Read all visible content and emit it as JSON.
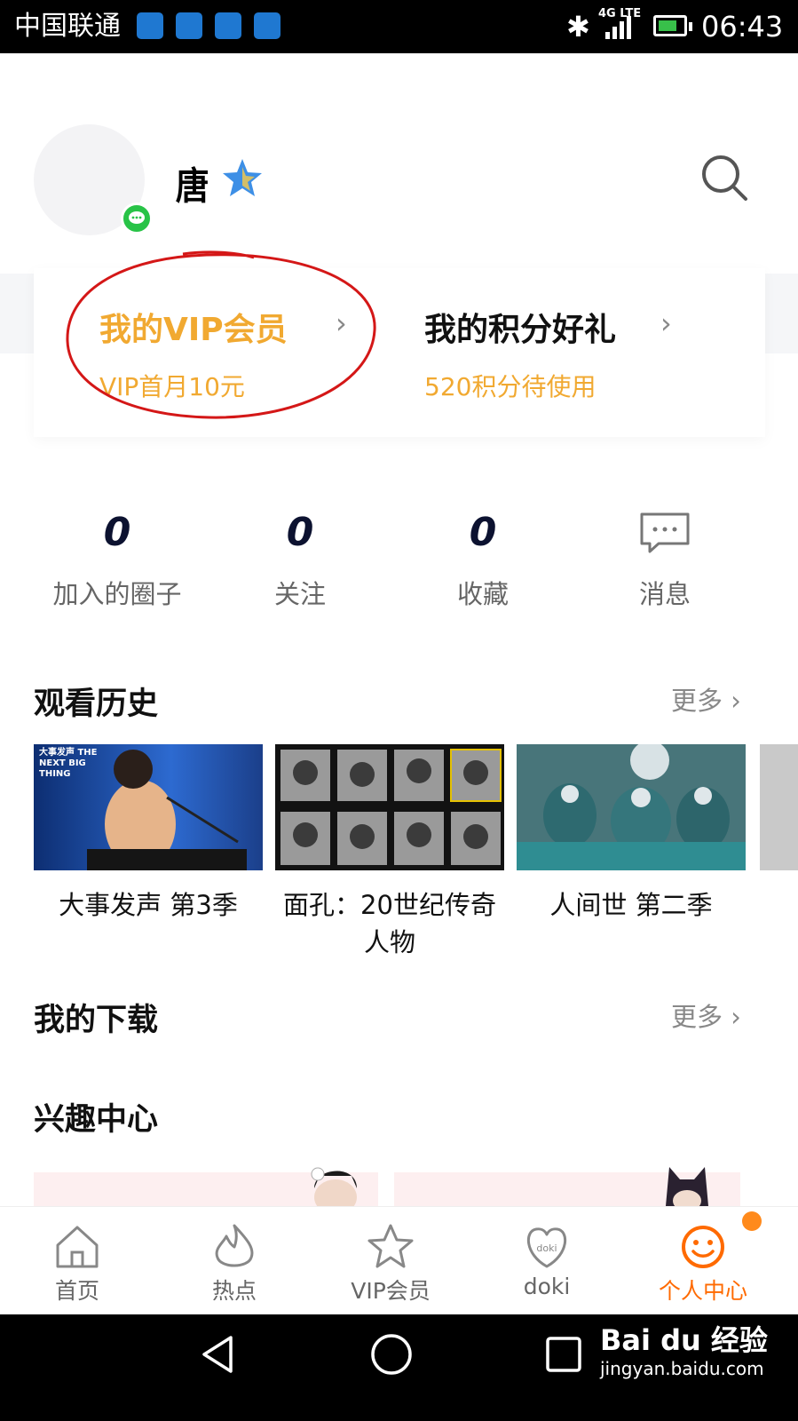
{
  "status_bar": {
    "carrier": "中国联通",
    "network": "4G LTE",
    "time": "06:43"
  },
  "profile": {
    "name": "唐"
  },
  "vip_card": {
    "vip_title": "我的VIP会员",
    "vip_sub": "VIP首月10元",
    "points_title": "我的积分好礼",
    "points_sub": "520积分待使用"
  },
  "stats": [
    {
      "value": "0",
      "label": "加入的圈子"
    },
    {
      "value": "0",
      "label": "关注"
    },
    {
      "value": "0",
      "label": "收藏"
    },
    {
      "label": "消息"
    }
  ],
  "history": {
    "title": "观看历史",
    "more": "更多",
    "items": [
      {
        "title": "大事发声 第3季",
        "thumb_text": "大事发声 THE NEXT BIG THING"
      },
      {
        "title": "面孔：20世纪传奇人物"
      },
      {
        "title": "人间世 第二季"
      }
    ]
  },
  "downloads": {
    "title": "我的下载",
    "more": "更多"
  },
  "interest": {
    "title": "兴趣中心"
  },
  "bottom_nav": [
    {
      "label": "首页",
      "icon": "home-icon"
    },
    {
      "label": "热点",
      "icon": "flame-icon"
    },
    {
      "label": "VIP会员",
      "icon": "vip-star-icon"
    },
    {
      "label": "doki",
      "icon": "doki-heart-icon"
    },
    {
      "label": "个人中心",
      "icon": "smile-icon",
      "active": true
    }
  ],
  "watermark": {
    "brand": "Bai du 经验",
    "url": "jingyan.baidu.com"
  },
  "colors": {
    "accent": "#f1a931",
    "active_nav": "#ff6a00",
    "wechat": "#28c347"
  }
}
